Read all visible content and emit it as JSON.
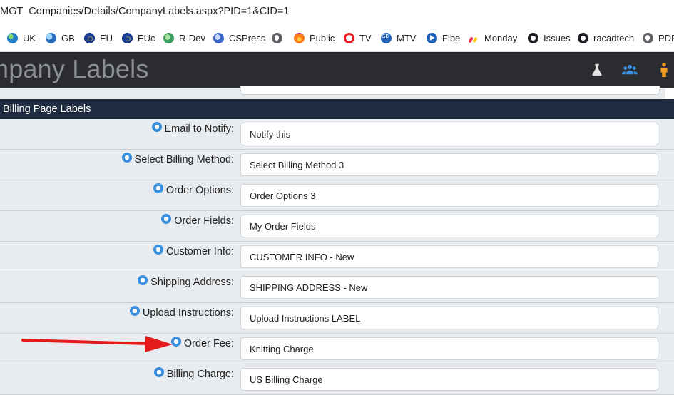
{
  "browser": {
    "url": "MGT_Companies/Details/CompanyLabels.aspx?PID=1&CID=1",
    "bookmarks": [
      {
        "label": "UK",
        "icon": "globe-icon"
      },
      {
        "label": "GB",
        "icon": "globe-icon"
      },
      {
        "label": "EU",
        "icon": "eu-flag-icon"
      },
      {
        "label": "EUc",
        "icon": "eu-flag-icon"
      },
      {
        "label": "R-Dev",
        "icon": "globe-icon"
      },
      {
        "label": "CSPress",
        "icon": "globe-icon"
      },
      {
        "label": "",
        "icon": "globe-icon"
      },
      {
        "label": "Public",
        "icon": "firefox-icon"
      },
      {
        "label": "TV",
        "icon": "tv-icon"
      },
      {
        "label": "MTV",
        "icon": "mtv-icon"
      },
      {
        "label": "Fibe",
        "icon": "fibe-play-icon"
      },
      {
        "label": "Monday",
        "icon": "monday-icon"
      },
      {
        "label": "Issues",
        "icon": "github-icon"
      },
      {
        "label": "racadtech",
        "icon": "github-icon"
      },
      {
        "label": "PDFS",
        "icon": "globe-icon"
      }
    ]
  },
  "header": {
    "title": "mpany Labels",
    "icons": [
      {
        "name": "flask-icon",
        "color": "#e0e0e0"
      },
      {
        "name": "users-icon",
        "color": "#3a8fde"
      },
      {
        "name": "person-icon",
        "color": "#f0a020"
      }
    ]
  },
  "section": {
    "title": "Billing Page Labels"
  },
  "rows": [
    {
      "label": "Email to Notify:",
      "value": "Notify this"
    },
    {
      "label": "Select Billing Method:",
      "value": "Select Billing Method 3"
    },
    {
      "label": "Order Options:",
      "value": "Order Options 3"
    },
    {
      "label": "Order Fields:",
      "value": "My Order Fields"
    },
    {
      "label": "Customer Info:",
      "value": "CUSTOMER INFO - New"
    },
    {
      "label": "Shipping Address:",
      "value": "SHIPPING ADDRESS - New"
    },
    {
      "label": "Upload Instructions:",
      "value": "Upload Instructions LABEL"
    },
    {
      "label": "Order Fee:",
      "value": "Knitting Charge"
    },
    {
      "label": "Billing Charge:",
      "value": "US Billing Charge"
    }
  ],
  "annotation": {
    "color": "#e41b1b"
  }
}
